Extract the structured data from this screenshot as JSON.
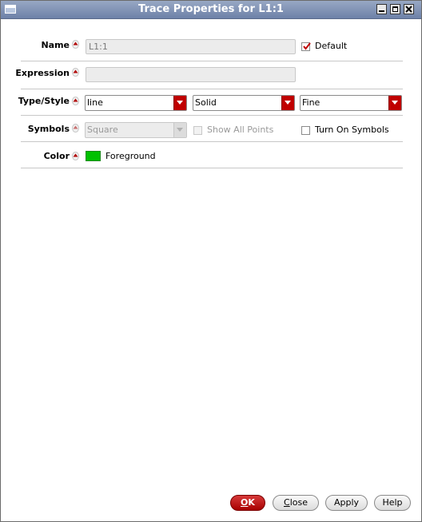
{
  "window": {
    "title": "Trace Properties for L1:1"
  },
  "colors": {
    "titlebar": "#7d90b4",
    "accent": "#c00000",
    "swatch": "#00c000"
  },
  "name_row": {
    "label": "Name",
    "value": "L1:1",
    "default_label": "Default",
    "default_checked": true
  },
  "expression_row": {
    "label": "Expression",
    "value": ""
  },
  "type_row": {
    "label": "Type/Style",
    "type": "line",
    "style": "Solid",
    "width": "Fine"
  },
  "symbols_row": {
    "label": "Symbols",
    "symbol": "Square",
    "show_all_points_label": "Show All Points",
    "show_all_points_checked": false,
    "turn_on_label": "Turn On Symbols",
    "turn_on_checked": false
  },
  "color_row": {
    "label": "Color",
    "value": "Foreground",
    "swatch_color": "#00c000"
  },
  "buttons": {
    "ok": "OK",
    "close": "Close",
    "apply": "Apply",
    "help": "Help"
  }
}
